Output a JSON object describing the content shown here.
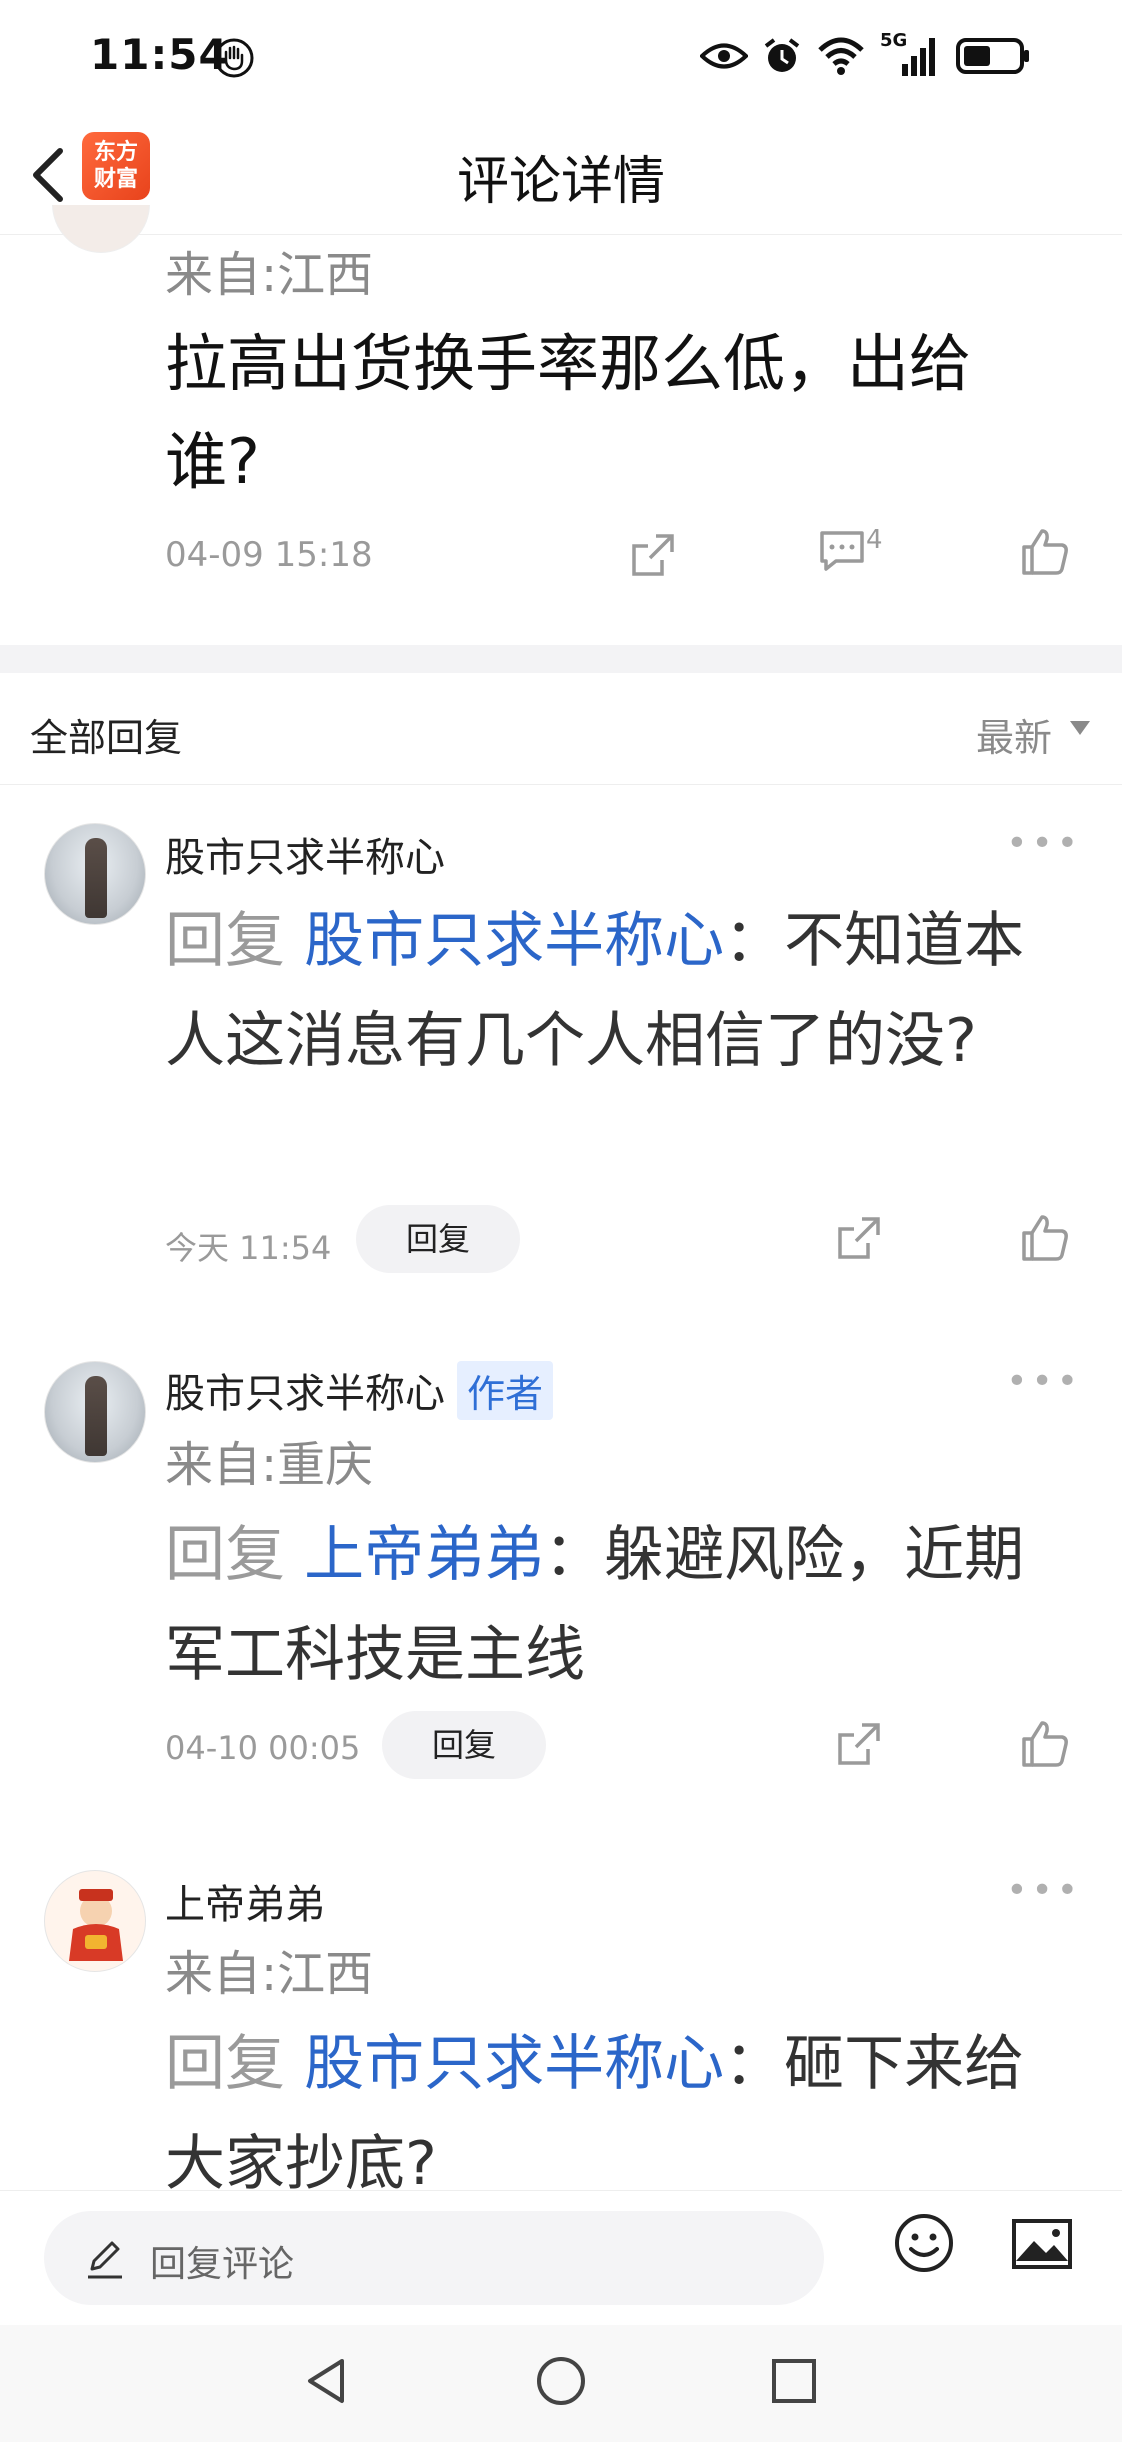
{
  "status_bar": {
    "time": "11:54",
    "network": "5G"
  },
  "nav": {
    "title": "评论详情",
    "app_logo_line1": "东方",
    "app_logo_line2": "财富"
  },
  "post": {
    "from": "来自:江西",
    "text": "拉高出货换手率那么低，出给谁?",
    "timestamp": "04-09 15:18",
    "comment_count": "4"
  },
  "replies_header": {
    "title": "全部回复",
    "sort": "最新"
  },
  "replies": [
    {
      "user": "股市只求半称心",
      "prefix": "回复",
      "mention": "股市只求半称心",
      "text": "：不知道本人这消息有几个人相信了的没?",
      "timestamp": "今天 11:54",
      "reply_label": "回复"
    },
    {
      "user": "股市只求半称心",
      "badge": "作者",
      "from": "来自:重庆",
      "prefix": "回复",
      "mention": "上帝弟弟",
      "text": "：躲避风险，近期军工科技是主线",
      "timestamp": "04-10 00:05",
      "reply_label": "回复"
    },
    {
      "user": "上帝弟弟",
      "from": "来自:江西",
      "prefix": "回复",
      "mention": "股市只求半称心",
      "text": "：砸下来给大家抄底?"
    }
  ],
  "bottom_bar": {
    "input_placeholder": "回复评论"
  },
  "icons": {
    "accent": "#2b66c9",
    "logo_color": "#e8431c"
  }
}
